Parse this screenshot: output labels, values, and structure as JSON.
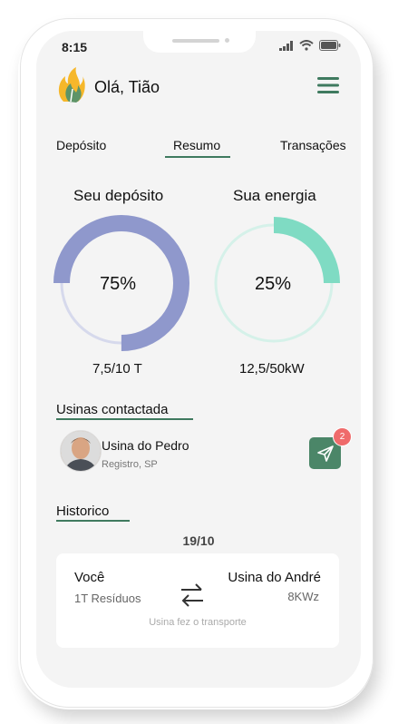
{
  "status_bar": {
    "time": "8:15"
  },
  "header": {
    "greeting": "Olá, Tião"
  },
  "tabs": [
    {
      "label": "Depósito"
    },
    {
      "label": "Resumo"
    },
    {
      "label": "Transações"
    }
  ],
  "active_tab": "Resumo",
  "charts": {
    "deposit": {
      "title": "Seu depósito",
      "percent_label": "75%",
      "value_label": "7,5/10 T",
      "fraction": 0.75,
      "color": "#8f98cc",
      "track_color": "#d6d9ec"
    },
    "energy": {
      "title": "Sua energia",
      "percent_label": "25%",
      "value_label": "12,5/50kW",
      "fraction": 0.25,
      "color": "#7fdbc3",
      "track_color": "#d5f1e9"
    }
  },
  "usinas": {
    "title": "Usinas contactada",
    "item": {
      "name": "Usina do Pedro",
      "location": "Registro, SP",
      "notification_count": "2"
    }
  },
  "historico": {
    "title": "Historico",
    "date": "19/10",
    "card": {
      "from_name": "Você",
      "from_detail": "1T Resíduos",
      "to_name": "Usina do André",
      "to_detail": "8KWz",
      "note": "Usina fez o transporte"
    }
  },
  "colors": {
    "accent": "#3f7a5f",
    "background": "#f4f4f4",
    "badge": "#ef6b6b"
  }
}
